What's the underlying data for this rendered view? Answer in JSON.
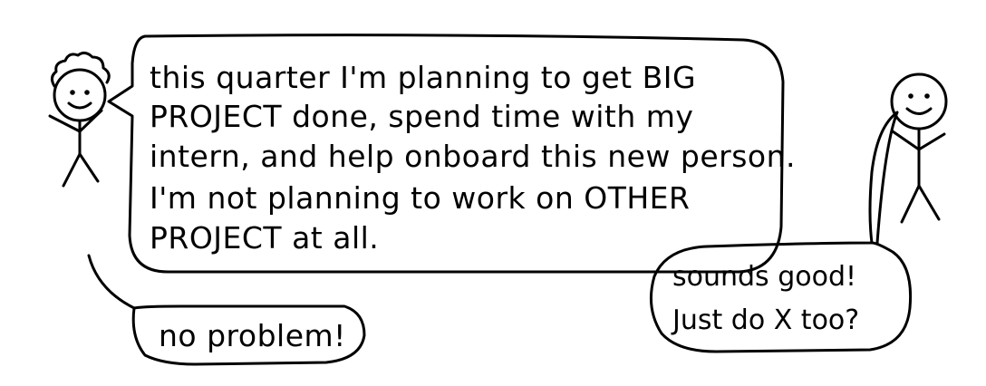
{
  "speech_main": {
    "line1": "this quarter I'm planning to get BIG",
    "line2": "PROJECT done, spend time with my",
    "line3": "intern, and help onboard this new person.",
    "line4": "I'm not planning to work on OTHER",
    "line5": "PROJECT at all."
  },
  "speech_left_reply": {
    "text": "no problem!"
  },
  "speech_right": {
    "line1": "sounds good!",
    "line2": "Just do X too?"
  }
}
